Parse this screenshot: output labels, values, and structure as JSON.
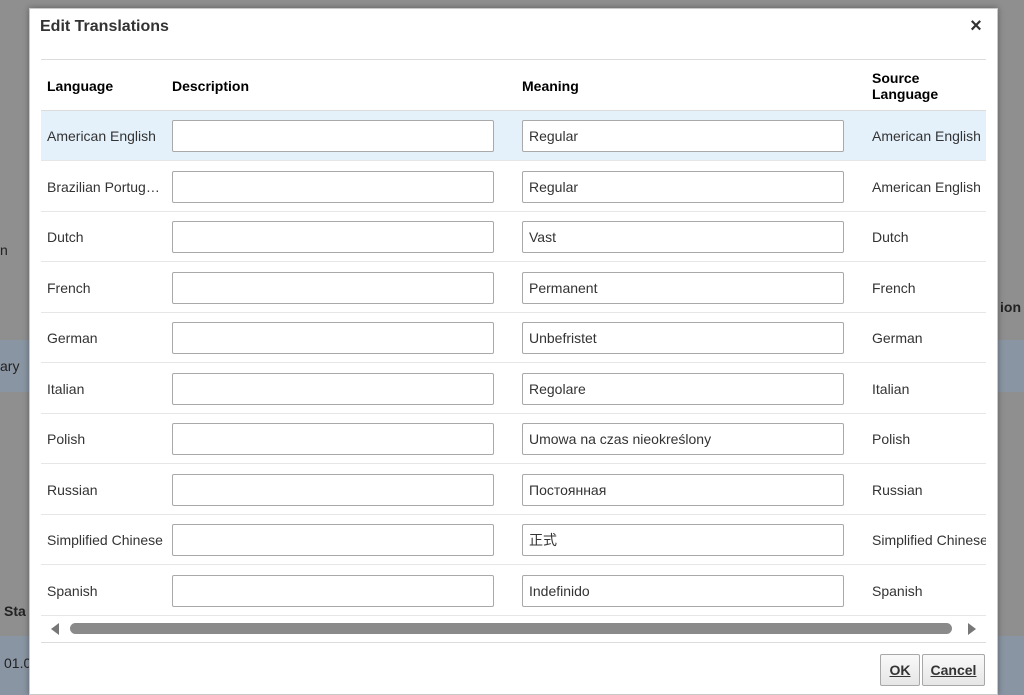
{
  "background": {
    "frag_ion": "ion",
    "frag_ary": "ary",
    "frag_n": "n",
    "frag_sta": "Sta",
    "frag_date": "01.0"
  },
  "modal": {
    "title": "Edit Translations",
    "close_label": "×"
  },
  "table": {
    "headers": {
      "language": "Language",
      "description": "Description",
      "meaning": "Meaning",
      "source_language": "Source Language"
    },
    "rows": [
      {
        "language": "American English",
        "description": "",
        "meaning": "Regular",
        "source": "American English"
      },
      {
        "language": "Brazilian Portuguese",
        "description": "",
        "meaning": "Regular",
        "source": "American English"
      },
      {
        "language": "Dutch",
        "description": "",
        "meaning": "Vast",
        "source": "Dutch"
      },
      {
        "language": "French",
        "description": "",
        "meaning": "Permanent",
        "source": "French"
      },
      {
        "language": "German",
        "description": "",
        "meaning": "Unbefristet",
        "source": "German"
      },
      {
        "language": "Italian",
        "description": "",
        "meaning": "Regolare",
        "source": "Italian"
      },
      {
        "language": "Polish",
        "description": "",
        "meaning": "Umowa na czas nieokreślony",
        "source": "Polish"
      },
      {
        "language": "Russian",
        "description": "",
        "meaning": "Постоянная",
        "source": "Russian"
      },
      {
        "language": "Simplified Chinese",
        "description": "",
        "meaning": "正式",
        "source": "Simplified Chinese"
      },
      {
        "language": "Spanish",
        "description": "",
        "meaning": "Indefinido",
        "source": "Spanish"
      }
    ],
    "selected_row": 0
  },
  "footer": {
    "ok_label": "OK",
    "cancel_label": "Cancel"
  }
}
